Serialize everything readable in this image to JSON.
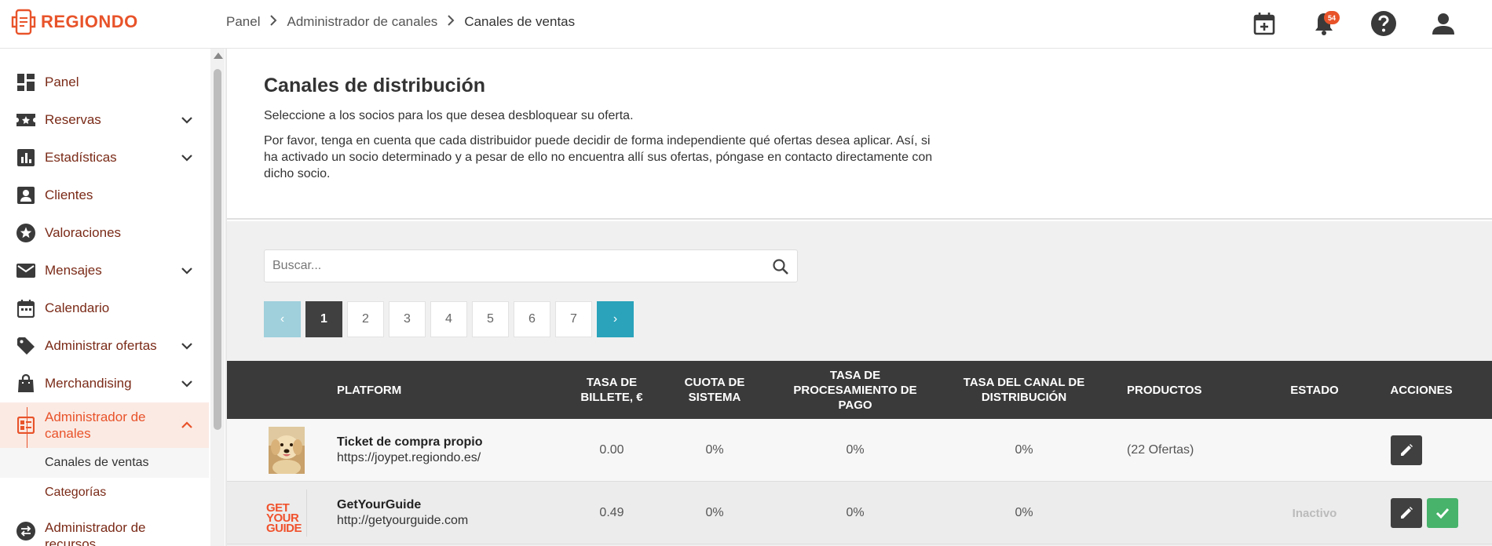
{
  "app": {
    "brand": "REGIONDO"
  },
  "breadcrumb": {
    "items": [
      "Panel",
      "Administrador de canales",
      "Canales de ventas"
    ]
  },
  "header": {
    "notifications_count": "54"
  },
  "sidebar": {
    "items": [
      {
        "label": "Panel",
        "icon": "dashboard-icon",
        "has_chevron": false
      },
      {
        "label": "Reservas",
        "icon": "ticket-icon",
        "has_chevron": true
      },
      {
        "label": "Estadísticas",
        "icon": "bar-chart-icon",
        "has_chevron": true
      },
      {
        "label": "Clientes",
        "icon": "contact-icon",
        "has_chevron": false
      },
      {
        "label": "Valoraciones",
        "icon": "star-icon",
        "has_chevron": false
      },
      {
        "label": "Mensajes",
        "icon": "mail-icon",
        "has_chevron": true
      },
      {
        "label": "Calendario",
        "icon": "calendar-icon",
        "has_chevron": false
      },
      {
        "label": "Administrar ofertas",
        "icon": "tag-icon",
        "has_chevron": true
      },
      {
        "label": "Merchandising",
        "icon": "shopping-bag-icon",
        "has_chevron": true
      },
      {
        "label": "Administrador de canales",
        "icon": "channels-icon",
        "has_chevron": true,
        "expanded": true
      },
      {
        "label": "Administrador de recursos",
        "icon": "swap-icon",
        "has_chevron": false
      }
    ],
    "subitems": [
      "Canales de ventas",
      "Categorías"
    ]
  },
  "intro": {
    "title": "Canales de distribución",
    "p1": "Seleccione a los socios para los que desea desbloquear su oferta.",
    "p2": "Por favor, tenga en cuenta que cada distribuidor puede decidir de forma independiente qué ofertas desea aplicar. Así, si ha activado un socio determinado y a pesar de ello no encuentra allí sus ofertas, póngase en contacto directamente con dicho socio."
  },
  "search": {
    "placeholder": "Buscar...",
    "value": ""
  },
  "pagination": {
    "pages": [
      "1",
      "2",
      "3",
      "4",
      "5",
      "6",
      "7"
    ],
    "current": "1",
    "prev": "‹",
    "next": "›"
  },
  "table": {
    "columns": {
      "platform": "PLATFORM",
      "ticket_fee": "TASA DE BILLETE, €",
      "system_fee": "CUOTA DE SISTEMA",
      "payment_fee": "TASA DE PROCESAMIENTO DE PAGO",
      "channel_fee": "TASA DEL CANAL DE DISTRIBUCIÓN",
      "products": "PRODUCTOS",
      "status": "ESTADO",
      "actions": "ACCIONES"
    },
    "rows": [
      {
        "name": "Ticket de compra propio",
        "url": "https://joypet.regiondo.es/",
        "ticket_fee": "0.00",
        "system_fee": "0%",
        "payment_fee": "0%",
        "channel_fee": "0%",
        "products": "(22 Ofertas)",
        "status": ""
      },
      {
        "name": "GetYourGuide",
        "url": "http://getyourguide.com",
        "ticket_fee": "0.49",
        "system_fee": "0%",
        "payment_fee": "0%",
        "channel_fee": "0%",
        "products": "",
        "status": "Inactivo",
        "logo_lines": [
          "GET",
          "YOUR",
          "GUIDE"
        ]
      }
    ]
  },
  "colors": {
    "brand": "#e8532a",
    "header_dark": "#3a3a3a",
    "pager_active": "#2aa3bb",
    "success": "#47b36b"
  }
}
